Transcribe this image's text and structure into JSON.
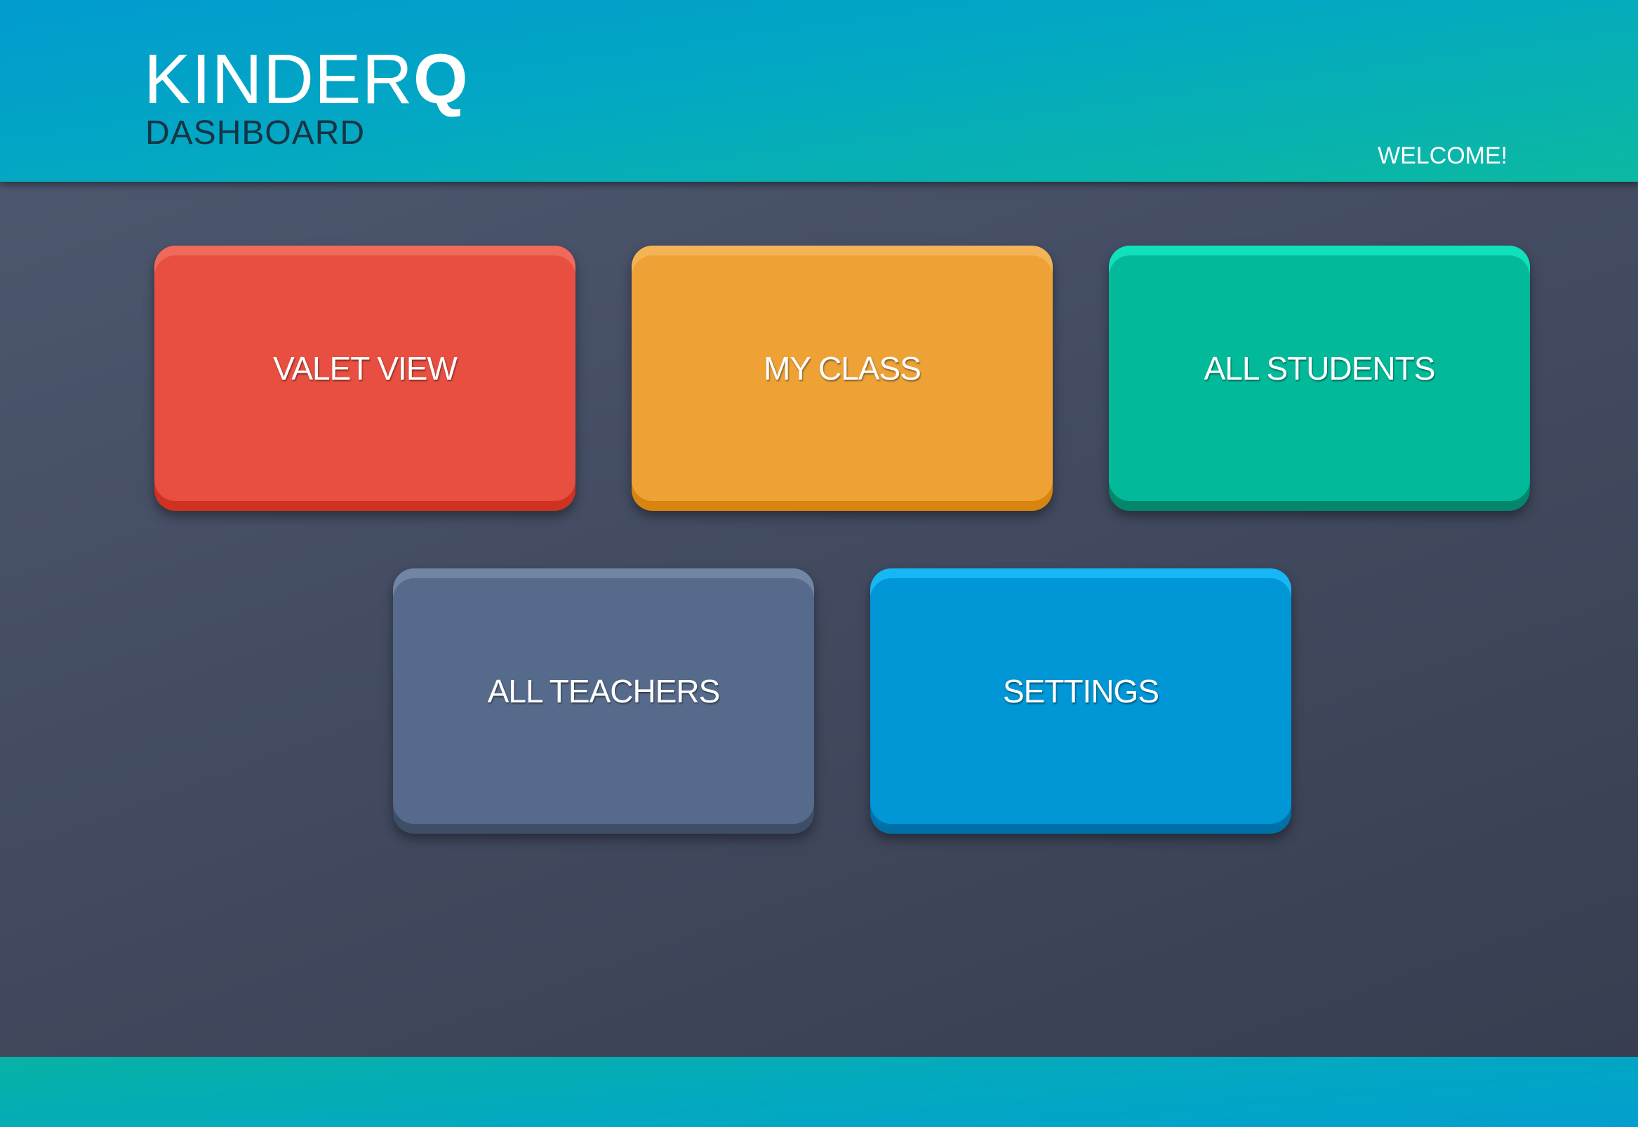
{
  "header": {
    "brand_light": "KINDER",
    "brand_bold": "Q",
    "subtitle": "DASHBOARD",
    "welcome": "WELCOME!"
  },
  "tiles": [
    {
      "label": "VALET VIEW",
      "color": "#e84f40"
    },
    {
      "label": "MY CLASS",
      "color": "#eea236"
    },
    {
      "label": "ALL STUDENTS",
      "color": "#02ba9a"
    },
    {
      "label": "ALL TEACHERS",
      "color": "#566b8b"
    },
    {
      "label": "SETTINGS",
      "color": "#0196d6"
    }
  ],
  "colors": {
    "header_start": "#019bcf",
    "header_end": "#0cb9a1",
    "background": "#434c62"
  }
}
